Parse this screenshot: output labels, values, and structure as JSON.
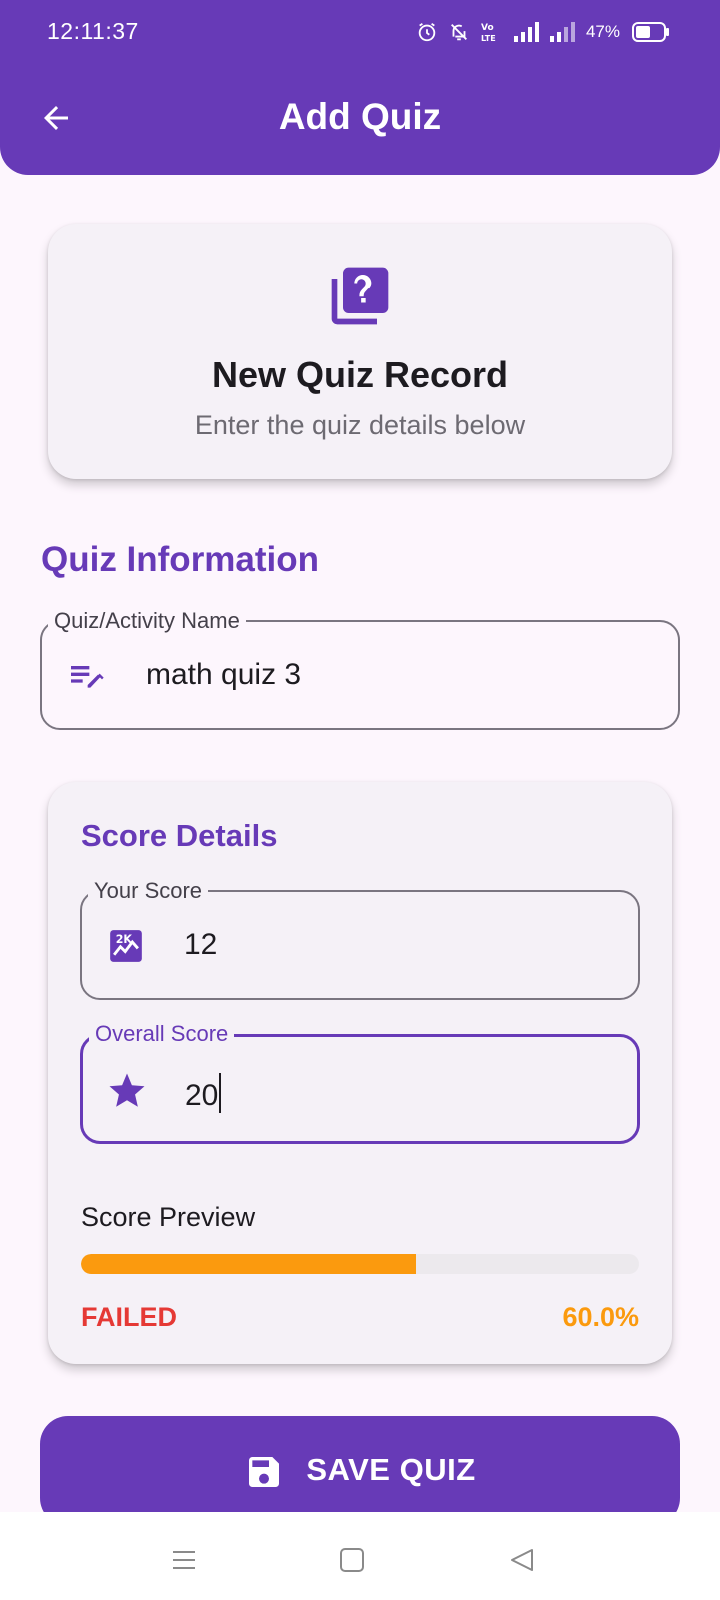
{
  "status_bar": {
    "time": "12:11:37",
    "battery": "47%",
    "icons": [
      "alarm-icon",
      "bell-off-icon",
      "volte-icon",
      "signal-icon",
      "signal-icon",
      "battery-icon"
    ]
  },
  "header": {
    "title": "Add Quiz",
    "back_icon": "arrow-back-icon"
  },
  "intro_card": {
    "icon": "quiz-library-icon",
    "title": "New Quiz Record",
    "subtitle": "Enter the quiz details below"
  },
  "quiz_info": {
    "section_title": "Quiz Information",
    "name_field": {
      "label": "Quiz/Activity Name",
      "value": "math quiz 3",
      "icon": "edit-note-icon"
    }
  },
  "score_details": {
    "title": "Score Details",
    "your_score": {
      "label": "Your Score",
      "value": "12",
      "icon": "score-icon"
    },
    "overall_score": {
      "label": "Overall Score",
      "value": "20",
      "icon": "star-icon"
    },
    "preview": {
      "label": "Score Preview",
      "progress_fraction": 0.6,
      "status": "FAILED",
      "percent": "60.0%"
    }
  },
  "save_button": {
    "label": "SAVE QUIZ",
    "icon": "save-icon"
  },
  "nav_bar": {
    "items": [
      "menu-icon",
      "home-square-icon",
      "back-triangle-icon"
    ]
  },
  "colors": {
    "primary": "#673ab7",
    "fail": "#e53935",
    "warning": "#fb9a0e",
    "background": "#fdf6fd"
  }
}
